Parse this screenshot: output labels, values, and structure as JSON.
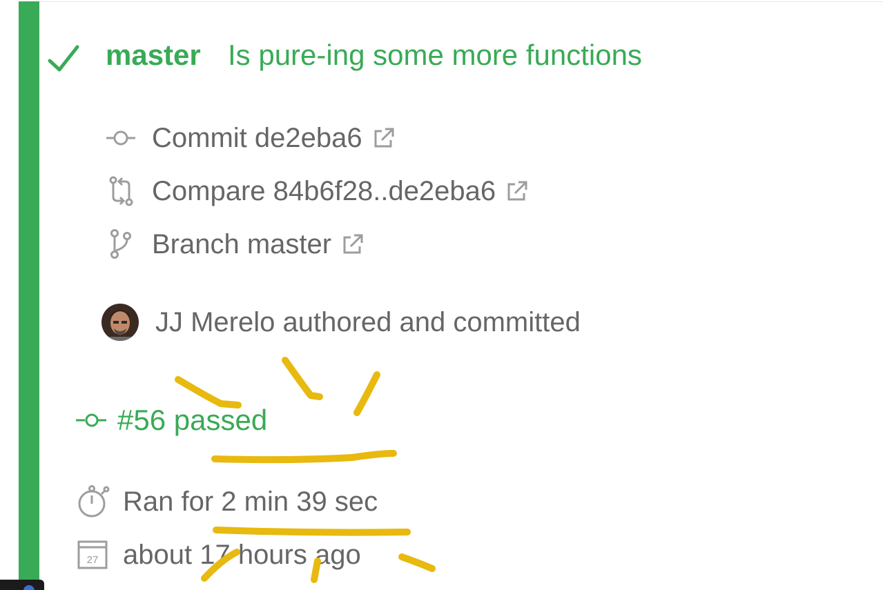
{
  "colors": {
    "success": "#39aa56",
    "muted_text": "#666666",
    "icon_gray": "#9d9d9d",
    "highlight": "#e8b90e"
  },
  "build": {
    "status_icon": "check-icon",
    "branch": "master",
    "message": "Is pure-ing some more functions",
    "commit_label": "Commit de2eba6",
    "compare_label": "Compare 84b6f28..de2eba6",
    "branch_label": "Branch master",
    "author_text": "JJ Merelo authored and committed",
    "number_label": "#56 passed",
    "duration_label": "Ran for 2 min 39 sec",
    "finished_label": "about 17 hours ago",
    "calendar_day": "27"
  }
}
